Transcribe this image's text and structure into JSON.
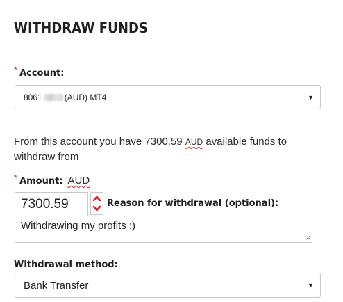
{
  "page": {
    "title": "WITHDRAW FUNDS"
  },
  "account": {
    "required_mark": "*",
    "label": "Account:",
    "value_prefix": "8061",
    "value_suffix": "(AUD) MT4"
  },
  "funds": {
    "text_before": "From this account you have 7300.59 ",
    "currency": "AUD",
    "text_after": " available funds to withdraw from"
  },
  "amount": {
    "required_mark": "*",
    "label": "Amount:",
    "currency": "AUD",
    "value": "7300.59"
  },
  "reason": {
    "label": "Reason for withdrawal (optional):",
    "value": "Withdrawing my profits :)"
  },
  "method": {
    "label": "Withdrawal method:",
    "selected": "Bank Transfer"
  },
  "colors": {
    "required": "#e0201b",
    "spinner_arrows": "#e0201b"
  },
  "icons": {
    "select_caret": "caret-down-icon",
    "spinner_up": "spin-up-icon",
    "spinner_down": "spin-down-icon",
    "resize": "resize-grip-icon"
  }
}
